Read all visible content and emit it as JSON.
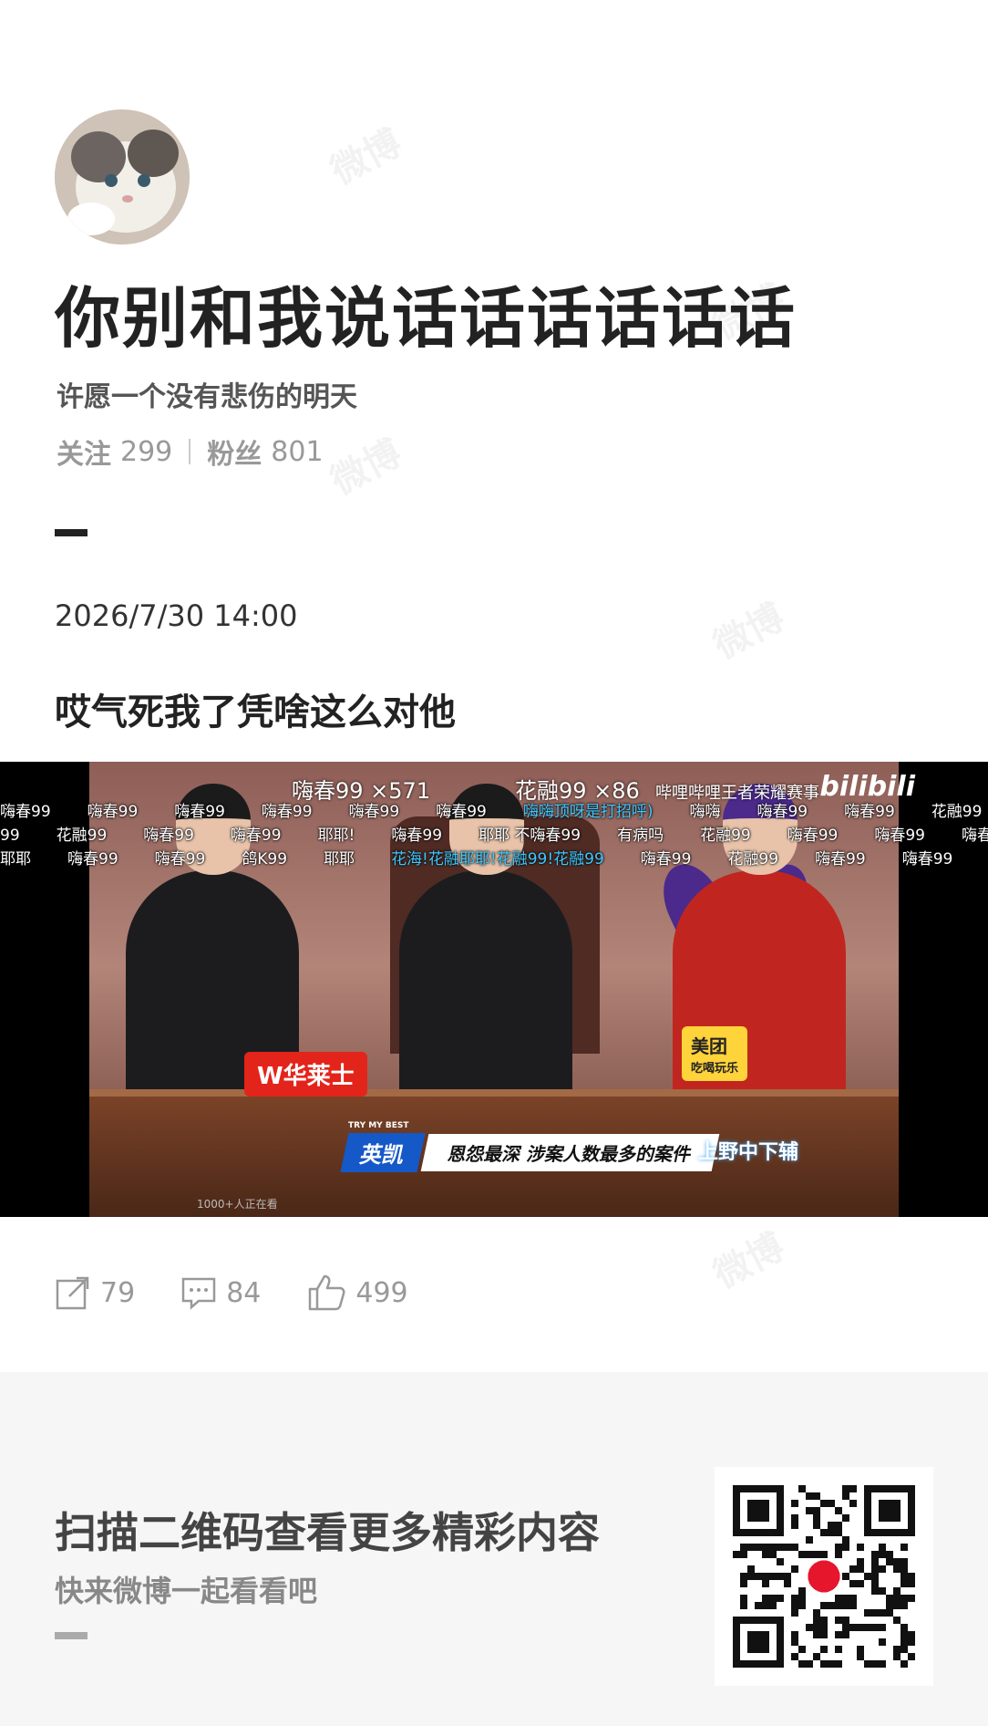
{
  "watermark": "微博",
  "profile": {
    "username": "你别和我说话话话话话话",
    "bio": "许愿一个没有悲伤的明天",
    "follow_label": "关注",
    "follow_count": "299",
    "fans_label": "粉丝",
    "fans_count": "801"
  },
  "post": {
    "date": "2026/7/30 14:00",
    "text": "哎气死我了凭啥这么对他"
  },
  "media": {
    "top_left_count": "嗨春99 ×571",
    "top_mid_count": "花融99 ×86",
    "brand": "哔哩哔哩王者荣耀赛事",
    "brand_logo": "bilibili",
    "sponsor1": "W华莱士",
    "sponsor2": "美团",
    "sponsor2_sub": "吃喝玩乐",
    "name": "英凯",
    "tag": "恩怨最深 涉案人数最多的案件",
    "tag_small": "TRY MY BEST",
    "right_logo": "上野中下辅",
    "viewer_text": "1000+人正在看",
    "danmaku_rows": [
      [
        "嗨春99",
        "嗨春99",
        "嗨春99",
        "嗨春99",
        "嗨春99",
        "嗨春99",
        "嗨嗨顶呀是打招呼)",
        "嗨嗨",
        "嗨春99",
        "嗨春99",
        "花融99",
        "嗨春99",
        "嗨春"
      ],
      [
        "99",
        "花融99",
        "嗨春99",
        "嗨春99",
        "耶耶!",
        "嗨春99",
        "耶耶 不嗨春99",
        "有病吗",
        "花融99",
        "嗨春99",
        "嗨春99",
        "嗨春99"
      ],
      [
        "耶耶",
        "嗨春99",
        "嗨春99",
        "鸽K99",
        "耶耶",
        "花海!花融耶耶!花融99!花融99",
        "嗨春99",
        "花融99",
        "嗨春99",
        "嗨春99",
        "嗨春"
      ]
    ]
  },
  "actions": {
    "repost_count": "79",
    "comment_count": "84",
    "like_count": "499"
  },
  "footer": {
    "title": "扫描二维码查看更多精彩内容",
    "subtitle": "快来微博一起看看吧"
  },
  "colors": {
    "title": "#222222",
    "muted": "#999999",
    "footer_bg": "#f6f6f6",
    "danmaku_highlight": "#3ec8ff"
  }
}
